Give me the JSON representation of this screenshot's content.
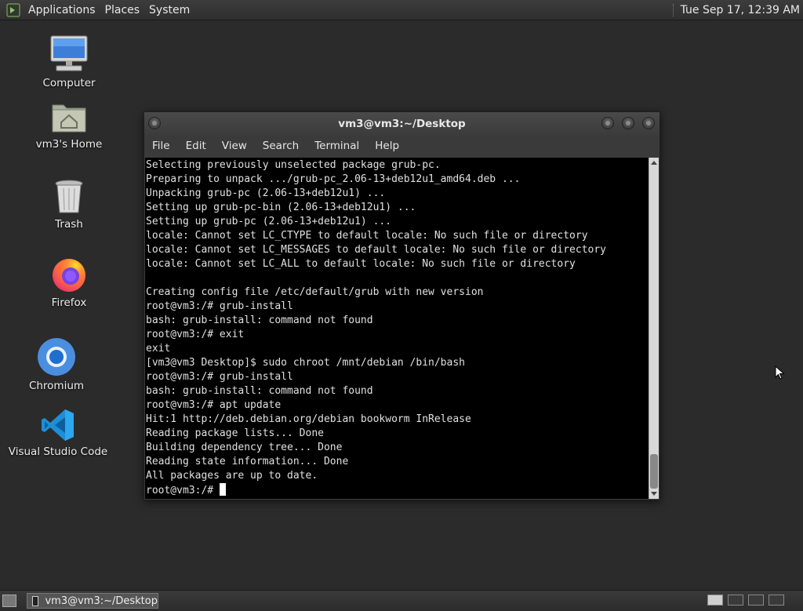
{
  "top_panel": {
    "menus": [
      "Applications",
      "Places",
      "System"
    ],
    "clock": "Tue Sep 17, 12:39 AM"
  },
  "desktop": {
    "icons": [
      {
        "label": "Computer",
        "icon": "computer-icon"
      },
      {
        "label": "vm3's Home",
        "icon": "home-folder-icon"
      },
      {
        "label": "Trash",
        "icon": "trash-icon"
      },
      {
        "label": "Firefox",
        "icon": "firefox-icon"
      },
      {
        "label": "Chromium",
        "icon": "chromium-icon"
      },
      {
        "label": "Visual Studio Code",
        "icon": "vscode-icon"
      }
    ]
  },
  "window": {
    "title": "vm3@vm3:~/Desktop",
    "menus": [
      "File",
      "Edit",
      "View",
      "Search",
      "Terminal",
      "Help"
    ]
  },
  "terminal": {
    "lines": [
      "Selecting previously unselected package grub-pc.",
      "Preparing to unpack .../grub-pc_2.06-13+deb12u1_amd64.deb ...",
      "Unpacking grub-pc (2.06-13+deb12u1) ...",
      "Setting up grub-pc-bin (2.06-13+deb12u1) ...",
      "Setting up grub-pc (2.06-13+deb12u1) ...",
      "locale: Cannot set LC_CTYPE to default locale: No such file or directory",
      "locale: Cannot set LC_MESSAGES to default locale: No such file or directory",
      "locale: Cannot set LC_ALL to default locale: No such file or directory",
      "",
      "Creating config file /etc/default/grub with new version",
      "root@vm3:/# grub-install",
      "bash: grub-install: command not found",
      "root@vm3:/# exit",
      "exit",
      "[vm3@vm3 Desktop]$ sudo chroot /mnt/debian /bin/bash",
      "root@vm3:/# grub-install",
      "bash: grub-install: command not found",
      "root@vm3:/# apt update",
      "Hit:1 http://deb.debian.org/debian bookworm InRelease",
      "Reading package lists... Done",
      "Building dependency tree... Done",
      "Reading state information... Done",
      "All packages are up to date."
    ],
    "prompt": "root@vm3:/# "
  },
  "taskbar": {
    "task_label": "vm3@vm3:~/Desktop"
  },
  "colors": {
    "terminal_bg": "#000000",
    "terminal_fg": "#e0e0e0",
    "panel_bg": "#333333",
    "desktop_bg": "#2b2b2b"
  }
}
